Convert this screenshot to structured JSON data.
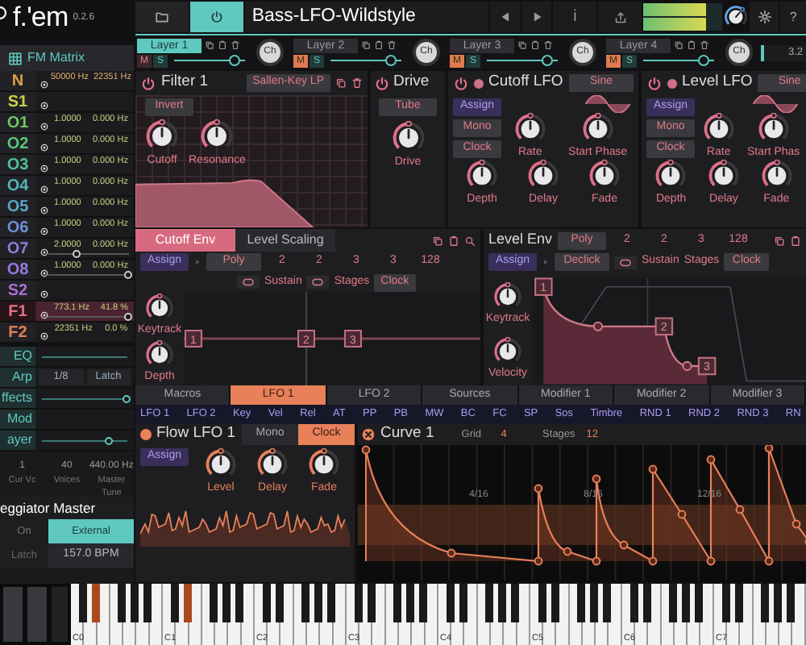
{
  "header": {
    "logo": "f.'em",
    "version": "0.2.6",
    "preset": "Bass-LFO-Wildstyle",
    "power_on": true,
    "info": "i",
    "help": "?"
  },
  "meters": [
    {
      "level": 0.8
    },
    {
      "level": 0.8
    }
  ],
  "layers": [
    {
      "label": "Layer 1",
      "selected": true,
      "muted": false,
      "m": "M",
      "s": "S",
      "level": 0.85,
      "knob": "Ch"
    },
    {
      "label": "Layer 2",
      "selected": false,
      "muted": true,
      "m": "M",
      "s": "S",
      "level": 0.85,
      "knob": "Ch"
    },
    {
      "label": "Layer 3",
      "selected": false,
      "muted": true,
      "m": "M",
      "s": "S",
      "level": 0.85,
      "knob": "Ch"
    },
    {
      "label": "Layer 4",
      "selected": false,
      "muted": true,
      "m": "M",
      "s": "S",
      "level": 0.85,
      "knob": "Ch"
    }
  ],
  "layer_field": "3.2",
  "fm_matrix": {
    "title": "FM Matrix",
    "rows": [
      {
        "label": "N",
        "color": "#e0a040",
        "values": [
          "50000 Hz",
          "22351 Hz"
        ],
        "selected": false
      },
      {
        "label": "S1",
        "color": "#c8d048",
        "values": [],
        "selected": false
      },
      {
        "label": "O1",
        "color": "#70c860",
        "values": [
          "1.0000",
          "0.000 Hz"
        ],
        "selected": false
      },
      {
        "label": "O2",
        "color": "#58c878",
        "values": [
          "1.0000",
          "0.000 Hz"
        ],
        "selected": false
      },
      {
        "label": "O3",
        "color": "#50c098",
        "values": [
          "1.0000",
          "0.000 Hz"
        ],
        "selected": false
      },
      {
        "label": "O4",
        "color": "#50b8b8",
        "values": [
          "1.0000",
          "0.000 Hz"
        ],
        "selected": false
      },
      {
        "label": "O5",
        "color": "#58a8c8",
        "values": [
          "1.0000",
          "0.000 Hz"
        ],
        "selected": false
      },
      {
        "label": "O6",
        "color": "#7090d8",
        "values": [
          "1.0000",
          "0.000 Hz"
        ],
        "selected": false
      },
      {
        "label": "O7",
        "color": "#8880e0",
        "values": [
          "2.0000",
          "0.000 Hz"
        ],
        "selected": false,
        "level": 0.35
      },
      {
        "label": "O8",
        "color": "#9878e0",
        "values": [
          "1.0000",
          "0.000 Hz"
        ],
        "selected": false,
        "level": 1
      },
      {
        "label": "S2",
        "color": "#a870d0",
        "values": [],
        "selected": false
      },
      {
        "label": "F1",
        "color": "#e07088",
        "values": [
          "773.1 Hz",
          "41.8 %"
        ],
        "selected": true,
        "level": 1
      },
      {
        "label": "F2",
        "color": "#e08058",
        "values": [
          "22351 Hz",
          "0.0 %"
        ],
        "selected": false
      }
    ]
  },
  "side_sections": [
    {
      "label": "EQ",
      "kind": "line"
    },
    {
      "label": "Arp",
      "kind": "buttons",
      "values": [
        "1/8",
        "Latch"
      ]
    },
    {
      "label": "ffects",
      "kind": "slider",
      "level": 1
    },
    {
      "label": "Mod",
      "kind": "plain"
    },
    {
      "label": "ayer",
      "kind": "slider",
      "level": 0.8
    }
  ],
  "stats": [
    {
      "value": "1",
      "label": "Cur Vc"
    },
    {
      "value": "40",
      "label": "Voices"
    },
    {
      "value": "440.00 Hz",
      "label": "Master Tune"
    }
  ],
  "arp_master": {
    "title": "eggiator Master",
    "options": [
      {
        "label": "On",
        "selected": false
      },
      {
        "label": "External",
        "selected": true
      }
    ],
    "latch": "Latch",
    "bpm": "157.0 BPM"
  },
  "filter": {
    "title": "Filter 1",
    "on": true,
    "type": "Sallen-Key LP",
    "invert": "Invert",
    "knobs": [
      {
        "label": "Cutoff"
      },
      {
        "label": "Resonance"
      }
    ]
  },
  "drive": {
    "title": "Drive",
    "on": true,
    "mode": "Tube",
    "knobs": [
      {
        "label": "Drive"
      }
    ]
  },
  "lfos": [
    {
      "title": "Cutoff LFO",
      "on": true,
      "wave": "Sine",
      "assign": "Assign",
      "mono": "Mono",
      "clock": "Clock",
      "knobs": [
        {
          "label": "Rate"
        },
        {
          "label": "Start Phase"
        },
        {
          "label": "Depth"
        },
        {
          "label": "Delay"
        },
        {
          "label": "Fade"
        }
      ]
    },
    {
      "title": "Level LFO",
      "on": true,
      "wave": "Sine",
      "assign": "Assign",
      "mono": "Mono",
      "clock": "Clock",
      "knobs": [
        {
          "label": "Rate"
        },
        {
          "label": "Start Phas"
        },
        {
          "label": "Depth"
        },
        {
          "label": "Delay"
        },
        {
          "label": "Fade"
        }
      ]
    }
  ],
  "cutoff_env": {
    "tabs": [
      {
        "label": "Cutoff Env",
        "selected": true
      },
      {
        "label": "Level Scaling",
        "selected": false
      }
    ],
    "assign": "Assign",
    "mode": "Poly",
    "values": [
      "2",
      "2",
      "3",
      "3",
      "128"
    ],
    "sustain": "Sustain",
    "stages": "Stages",
    "clock": "Clock",
    "knobs": [
      {
        "label": "Keytrack"
      },
      {
        "label": "Depth"
      }
    ],
    "nodes": [
      "1",
      "2",
      "3"
    ]
  },
  "level_env": {
    "title": "Level Env",
    "mode": "Poly",
    "values": [
      "2",
      "2",
      "3",
      "128"
    ],
    "assign": "Assign",
    "declick": "Declick",
    "sustain": "Sustain",
    "stages": "Stages",
    "clock": "Clock",
    "knobs": [
      {
        "label": "Keytrack"
      },
      {
        "label": "Velocity"
      }
    ],
    "nodes": [
      "1",
      "2",
      "3"
    ]
  },
  "mod_tabs": [
    {
      "label": "Macros",
      "selected": false
    },
    {
      "label": "LFO 1",
      "selected": true
    },
    {
      "label": "LFO 2",
      "selected": false
    },
    {
      "label": "Sources",
      "selected": false
    },
    {
      "label": "Modifier 1",
      "selected": false
    },
    {
      "label": "Modifier 2",
      "selected": false
    },
    {
      "label": "Modifier 3",
      "selected": false
    }
  ],
  "sources": [
    "LFO 1",
    "LFO 2",
    "Key",
    "Vel",
    "Rel",
    "AT",
    "PP",
    "PB",
    "MW",
    "BC",
    "FC",
    "SP",
    "Sos",
    "Timbre",
    "RND 1",
    "RND 2",
    "RND 3",
    "RN"
  ],
  "flow_lfo": {
    "title": "Flow LFO 1",
    "options": [
      {
        "label": "Mono",
        "selected": false
      },
      {
        "label": "Clock",
        "selected": true
      }
    ],
    "assign": "Assign",
    "knobs": [
      {
        "label": "Level"
      },
      {
        "label": "Delay"
      },
      {
        "label": "Fade"
      }
    ]
  },
  "curve": {
    "title": "Curve 1",
    "grid_label": "Grid",
    "grid": "4",
    "stages_label": "Stages",
    "stages": "12",
    "markers": [
      "4/16",
      "8/16",
      "12/16"
    ]
  },
  "keyboard": {
    "octaves": [
      {
        "label": "C0",
        "d_sharp_held": true
      },
      {
        "label": "C1",
        "d_sharp_held": true
      },
      {
        "label": "C2",
        "d_sharp_held": false
      },
      {
        "label": "C3",
        "d_sharp_held": false
      },
      {
        "label": "C4",
        "d_sharp_held": false
      },
      {
        "label": "C5",
        "d_sharp_held": false
      },
      {
        "label": "C6",
        "d_sharp_held": false
      },
      {
        "label": "C7",
        "d_sharp_held": false
      }
    ]
  }
}
